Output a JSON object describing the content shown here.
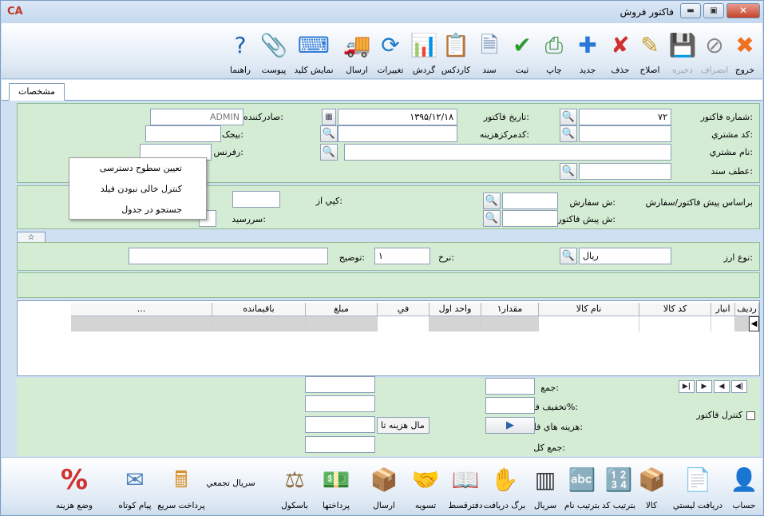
{
  "window": {
    "title": "فاکتور فروش",
    "logo": "CA"
  },
  "toolbar": [
    {
      "label": "خروج",
      "icon": "exit-icon",
      "glyph": "✖",
      "color": "#f0701e",
      "enabled": true
    },
    {
      "label": "انصراف",
      "icon": "cancel-icon",
      "glyph": "⊘",
      "color": "#8a8a8a",
      "enabled": false
    },
    {
      "label": "ذخیره",
      "icon": "save-icon",
      "glyph": "💾",
      "color": "#444",
      "enabled": false
    },
    {
      "label": "اصلاح",
      "icon": "edit-icon",
      "glyph": "✎",
      "color": "#c79a2a",
      "enabled": true
    },
    {
      "label": "حذف",
      "icon": "delete-icon",
      "glyph": "✘",
      "color": "#d0302f",
      "enabled": true
    },
    {
      "label": "جدید",
      "icon": "new-icon",
      "glyph": "✚",
      "color": "#2b78d8",
      "enabled": true
    },
    {
      "label": "چاپ",
      "icon": "print-icon",
      "glyph": "⎙",
      "color": "#3a8a3a",
      "enabled": true
    },
    {
      "label": "ثبت",
      "icon": "register-icon",
      "glyph": "✔",
      "color": "#2e9a2e",
      "enabled": true
    },
    {
      "label": "سند",
      "icon": "document-icon",
      "glyph": "🗎",
      "color": "#6a88b0",
      "enabled": true
    },
    {
      "label": "کاردکس",
      "icon": "cardex-icon",
      "glyph": "📋",
      "color": "#6b7b55",
      "enabled": true
    },
    {
      "label": "گردش",
      "icon": "turnover-chart-icon",
      "glyph": "📊",
      "color": "#2a7a3a",
      "enabled": true
    },
    {
      "label": "تغییرات",
      "icon": "changes-icon",
      "glyph": "⟳",
      "color": "#1f7ac8",
      "enabled": true
    },
    {
      "label": "ارسال",
      "icon": "send-truck-icon",
      "glyph": "🚚",
      "color": "#c0392b",
      "enabled": true
    },
    {
      "label": "نمایش کلید",
      "icon": "keyboard-icon",
      "glyph": "⌨",
      "color": "#2e7bd6",
      "enabled": true
    },
    {
      "label": "پیوست",
      "icon": "attachment-icon",
      "glyph": "📎",
      "color": "#a07820",
      "enabled": true
    },
    {
      "label": "راهنما",
      "icon": "help-icon",
      "glyph": "?",
      "color": "#1f5fb8",
      "enabled": true
    }
  ],
  "tabs": {
    "active": "مشخصات"
  },
  "header": {
    "invoice_no_label": "شماره فاکتور:",
    "invoice_no": "۷۲",
    "invoice_date_label": "تاریخ فاکتور:",
    "invoice_date": "۱۳۹۵/۱۲/۱۸",
    "issuer_label": "صادرکننده:",
    "issuer": "ADMIN",
    "customer_code_label": "کد مشتري:",
    "customer_code": "",
    "cost_center_label": "کدمرکزهزینه:",
    "cost_center": "",
    "bijak_label": "بیجک:",
    "bijak": "",
    "customer_name_label": "نام مشتري:",
    "customer_name": "",
    "reference_label": "رفرنس:",
    "reference": "",
    "doc_ref_label": "عطف سند:",
    "doc_ref": ""
  },
  "context_menu": [
    "تعیین سطوح دسترسی",
    "کنترل خالی نبودن فیلد",
    "جستجو در جدول"
  ],
  "order_section": {
    "based_on_label": "براساس پیش فاکتور/سفارش",
    "order_no_label": "ش سفارش:",
    "order_no": "",
    "proforma_no_label": "ش پیش فاکتور:",
    "proforma_no": "",
    "copy_from_label": "کپي از:",
    "copy_from": "",
    "due_label": "سررسید:",
    "due": ""
  },
  "currency": {
    "type_label": "نوع ارز:",
    "type": "ریال",
    "rate_label": "نرخ:",
    "rate": "۱",
    "description_label": "توضیح:",
    "description": ""
  },
  "grid": {
    "columns": [
      "ردیف",
      "انبار",
      "کد کالا",
      "نام کالا",
      "مقدار۱",
      "واحد اول",
      "في",
      "مبلغ",
      "باقیمانده",
      "..."
    ]
  },
  "totals": {
    "sum_label": "جمع:",
    "sum": "",
    "discount_label": "تخفیف فاکتور%:",
    "discount": "",
    "costs_label": "هزینه هاي فاکتور:",
    "costs_button": "مال هزینه تا",
    "total_label": "جمع کل:",
    "total": "",
    "invoice_control_label": "کنترل فاکتور"
  },
  "bottombar": [
    {
      "label": "حساب",
      "icon": "account-icon",
      "glyph": "👤",
      "color": "#3a6ea5"
    },
    {
      "label": "دریافت لیستي",
      "icon": "list-receipt-icon",
      "glyph": "📄",
      "color": "#3a7fc8"
    },
    {
      "label": "کالا",
      "icon": "goods-box-icon",
      "glyph": "📦",
      "color": "#a07a3a"
    },
    {
      "label": "بترتیب کد",
      "icon": "sort-by-code-icon",
      "glyph": "🔢",
      "color": "#3a6fc8"
    },
    {
      "label": "بترتیب نام",
      "icon": "sort-by-name-icon",
      "glyph": "🔤",
      "color": "#2e7bd6"
    },
    {
      "label": "سریال",
      "icon": "barcode-icon",
      "glyph": "▥",
      "color": "#333"
    },
    {
      "label": "برگ دریافت",
      "icon": "receipt-hand-icon",
      "glyph": "✋",
      "color": "#3a7fc8"
    },
    {
      "label": "دفترقسط",
      "icon": "installment-book-icon",
      "glyph": "📖",
      "color": "#c99a2a"
    },
    {
      "label": "تسویه",
      "icon": "settle-icon",
      "glyph": "🤝",
      "color": "#c08a1a"
    },
    {
      "label": "ارسال",
      "icon": "send-icon",
      "glyph": "📦",
      "color": "#555"
    },
    {
      "label": "پرداختها",
      "icon": "payments-icon",
      "glyph": "💵",
      "color": "#2e8a3a"
    },
    {
      "label": "باسکول",
      "icon": "scale-icon",
      "glyph": "⚖",
      "color": "#8a6a3a"
    },
    {
      "label": "سریال تجمعي",
      "icon": "aggregate-serial-icon",
      "glyph": "",
      "color": "#555"
    },
    {
      "label": "پرداخت سریع",
      "icon": "quick-pay-icon",
      "glyph": "🖩",
      "color": "#d8902a"
    },
    {
      "label": "پیام کوتاه",
      "icon": "sms-icon",
      "glyph": "✉",
      "color": "#4a7fb8"
    },
    {
      "label": "وضع هزینه",
      "icon": "percent-icon",
      "glyph": "%",
      "color": "#d0302f"
    }
  ]
}
